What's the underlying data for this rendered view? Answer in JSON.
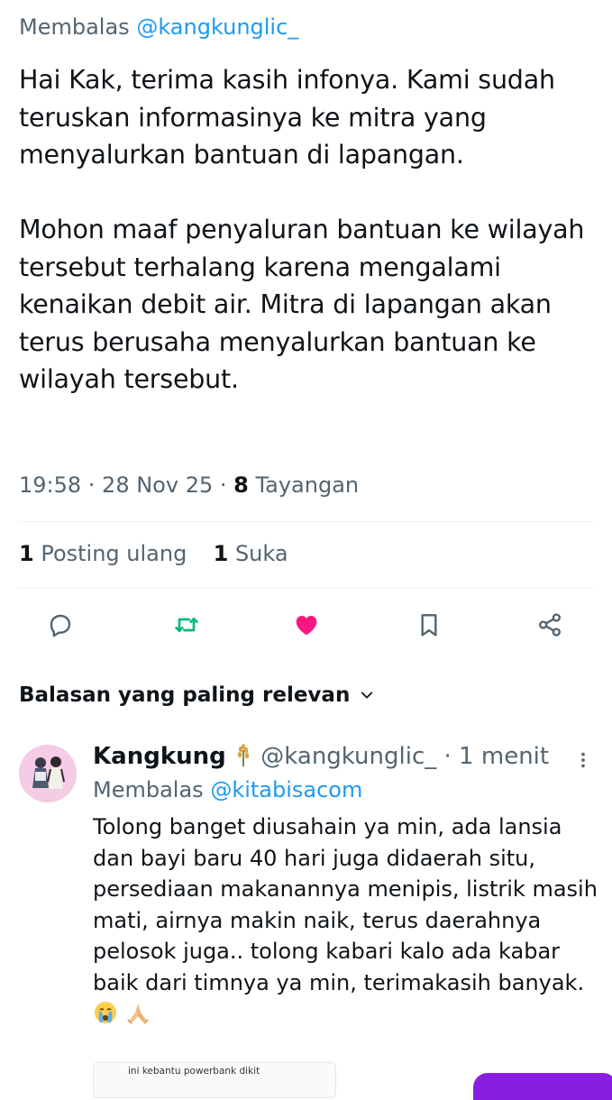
{
  "tweet": {
    "reply_prefix": "Membalas ",
    "reply_handle": "@kangkunglic_",
    "text": "Hai Kak, terima kasih infonya. Kami sudah teruskan informasinya ke mitra yang menyalurkan bantuan di lapangan.\n\nMohon maaf penyaluran bantuan ke wilayah tersebut terhalang karena mengalami kenaikan debit air. Mitra di lapangan akan terus berusaha menyalurkan bantuan ke wilayah tersebut.",
    "time": "19:58 · 28 Nov 25 · ",
    "views_count": "8",
    "views_label": " Tayangan"
  },
  "stats": {
    "reposts_count": "1",
    "reposts_label": " Posting ulang",
    "likes_count": "1",
    "likes_label": " Suka"
  },
  "actions": {
    "reply_icon": "reply-icon",
    "repost_icon": "repost-icon",
    "like_icon": "heart-icon",
    "bookmark_icon": "bookmark-icon",
    "share_icon": "share-icon",
    "repost_color": "#00ba7c",
    "like_color": "#f91880"
  },
  "replies_section": {
    "sort_label": "Balasan yang paling relevan"
  },
  "reply": {
    "name": "Kangkung",
    "name_emoji": "rice-stalk-emoji",
    "handle": "@kangkunglic_",
    "time": " · 1 menit",
    "reply_prefix": "Membalas ",
    "reply_handle": "@kitabisacom",
    "text": "Tolong banget diusahain ya min, ada lansia dan bayi baru 40 hari juga didaerah situ, persediaan makanannya menipis, listrik masih mati, airnya makin naik, terus daerahnya pelosok juga.. tolong kabari kalo ada kabar baik dari timnya ya min, terimakasih banyak. ",
    "emojis": [
      "crying-face-emoji",
      "folded-hands-emoji"
    ],
    "media_caption": "ini kebantu powerbank dikit"
  },
  "colors": {
    "link": "#1d9bf0",
    "secondary_text": "#536471",
    "primary_text": "#0f1419"
  }
}
